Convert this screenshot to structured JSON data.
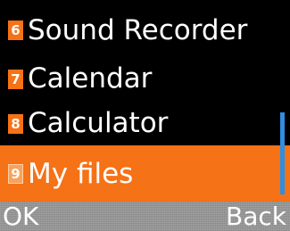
{
  "menu": {
    "items": [
      {
        "number": "6",
        "label": "Sound Recorder",
        "selected": false
      },
      {
        "number": "7",
        "label": "Calendar",
        "selected": false
      },
      {
        "number": "8",
        "label": "Calculator",
        "selected": false
      },
      {
        "number": "9",
        "label": "My files",
        "selected": true
      }
    ]
  },
  "softkeys": {
    "left": "OK",
    "right": "Back"
  },
  "colors": {
    "background": "#000000",
    "accent": "#f57216",
    "scrollbar": "#2f8fe0",
    "softkey_bar": "#9a9a9a",
    "text": "#ffffff"
  }
}
